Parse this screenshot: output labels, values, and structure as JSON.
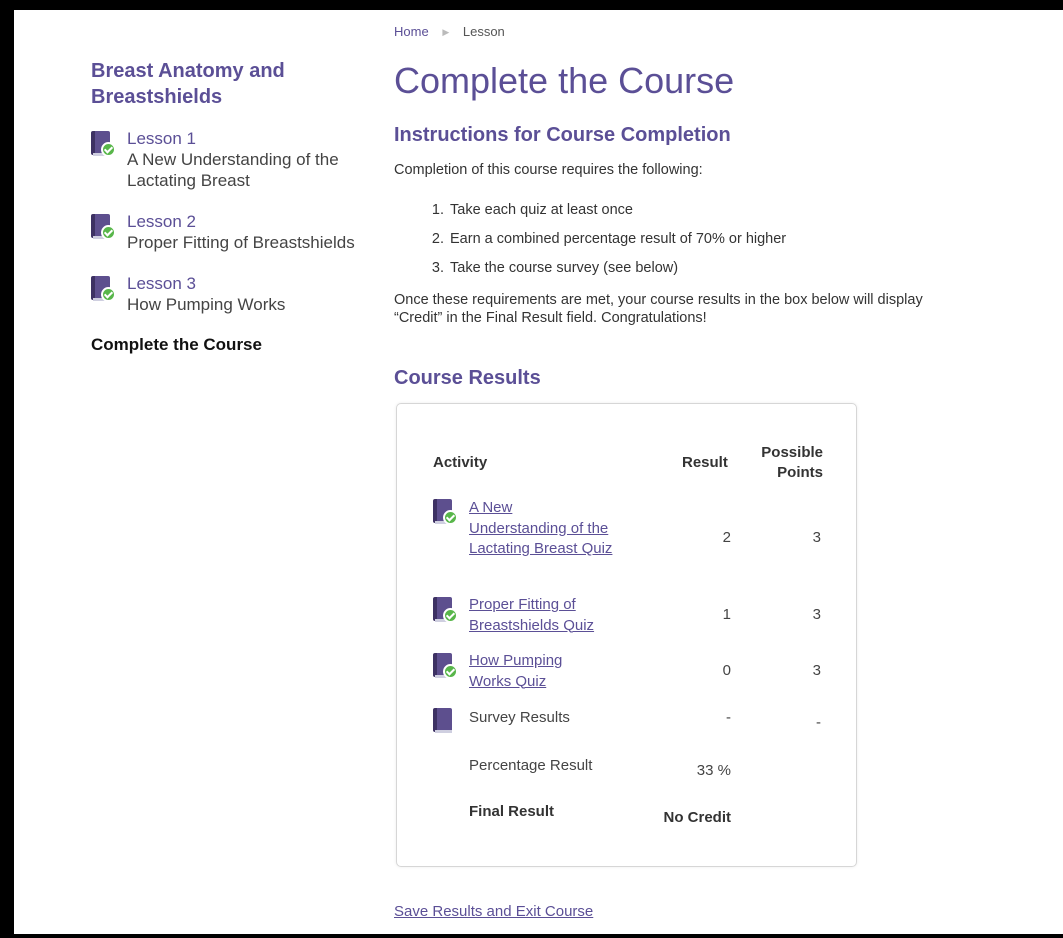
{
  "sidebar": {
    "course_title": "Breast Anatomy and Breastshields",
    "lessons": [
      {
        "number": "Lesson 1",
        "name": "A New Understanding of the Lactating Breast",
        "icon": "book-complete-icon"
      },
      {
        "number": "Lesson 2",
        "name": "Proper Fitting of Breastshields",
        "icon": "book-complete-icon"
      },
      {
        "number": "Lesson 3",
        "name": "How Pumping Works",
        "icon": "book-complete-icon"
      }
    ],
    "current_item": "Complete the Course"
  },
  "breadcrumb": {
    "home": "Home",
    "separator_icon": "triangle-right-icon",
    "current": "Lesson"
  },
  "page_title": "Complete the Course",
  "instructions": {
    "heading": "Instructions for Course Completion",
    "intro": "Completion of this course requires the following:",
    "requirements": [
      "Take each quiz at least once",
      "Earn a combined percentage result of 70% or higher",
      "Take the course survey (see below)"
    ],
    "note": "Once these requirements are met, your course results in the box below will display “Credit” in the Final Result field. Congratulations!"
  },
  "results": {
    "heading": "Course Results",
    "columns": {
      "activity": "Activity",
      "result": "Result",
      "possible_points": "Possible Points"
    },
    "rows": [
      {
        "activity": "A New Understanding of the Lactating Breast Quiz",
        "result": "2",
        "points": "3",
        "icon": "book-complete-icon"
      },
      {
        "activity": "Proper Fitting of Breastshields Quiz",
        "result": "1",
        "points": "3",
        "icon": "book-complete-icon"
      },
      {
        "activity": "How Pumping Works Quiz",
        "result": "0",
        "points": "3",
        "icon": "book-complete-icon"
      },
      {
        "activity": "Survey Results",
        "result": "-",
        "points": "-",
        "icon": "book-icon"
      }
    ],
    "percentage_label": "Percentage Result",
    "percentage_value": "33 %",
    "final_label": "Final Result",
    "final_value": "No Credit"
  },
  "save_link": "Save Results and Exit Course",
  "colors": {
    "accent": "#5b4f96",
    "check": "#58b64a"
  }
}
